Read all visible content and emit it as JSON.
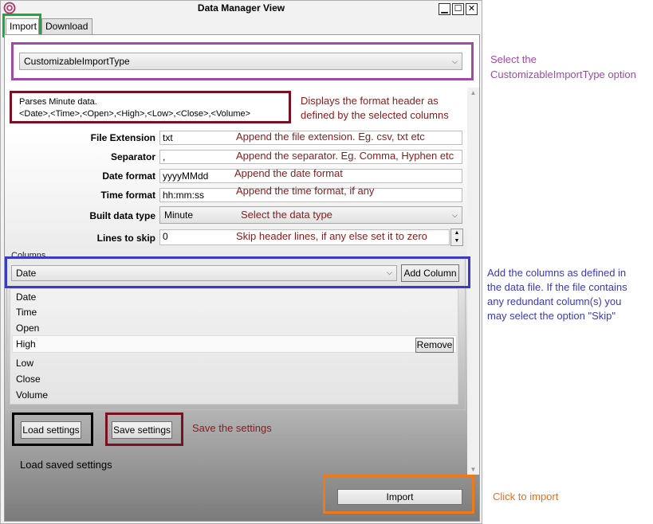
{
  "window": {
    "title": "Data Manager View",
    "minimize_glyph": "▁",
    "maximize_glyph": "☐",
    "close_glyph": "✕"
  },
  "tabs": [
    {
      "label": "Import",
      "active": true
    },
    {
      "label": "Download",
      "active": false
    }
  ],
  "import_type": {
    "selected": "CustomizableImportType"
  },
  "format_header": {
    "line1": "Parses Minute data.",
    "line2": "<Date>,<Time>,<Open>,<High>,<Low>,<Close>,<Volume>"
  },
  "fields": {
    "file_extension": {
      "label": "File Extension",
      "value": "txt"
    },
    "separator": {
      "label": "Separator",
      "value": ","
    },
    "date_format": {
      "label": "Date format",
      "value": "yyyyMMdd"
    },
    "time_format": {
      "label": "Time format",
      "value": "hh:mm:ss"
    },
    "built_data_type": {
      "label": "Built data type",
      "value": "Minute"
    },
    "lines_to_skip": {
      "label": "Lines to skip",
      "value": "0"
    }
  },
  "columns": {
    "group_label": "Columns",
    "selected": "Date",
    "add_label": "Add Column",
    "items": [
      "Date",
      "Time",
      "Open",
      "High",
      "Low",
      "Close",
      "Volume"
    ],
    "remove_label": "Remove"
  },
  "buttons": {
    "load_settings": "Load settings",
    "save_settings": "Save settings",
    "import": "Import"
  },
  "annotations": {
    "header_note": [
      "Displays the format header as",
      "defined by the selected columns"
    ],
    "file_extension_note": "Append the file extension. Eg. csv, txt etc",
    "separator_note": "Append the separator. Eg. Comma, Hyphen etc",
    "date_note": "Append the date format",
    "time_note": "Append the time format, if any",
    "data_type_note": "Select the data type",
    "skip_note": "Skip header lines, if any else set it to zero",
    "save_note": "Save the settings",
    "load_note": "Load saved settings",
    "select_option_note": [
      "Select the",
      "CustomizableImportType option"
    ],
    "columns_note": [
      "Add the columns as defined in",
      "the data file. If the file contains",
      "any redundant column(s) you",
      "may select the option \"Skip\""
    ],
    "import_note": "Click to import"
  },
  "colors": {
    "green_box": "#1fa83a",
    "purple_box": "#a04aa8",
    "maroon_box": "#7a1020",
    "blue_box": "#3a3ac8",
    "black_box": "#000000",
    "orange_box": "#f07a1a",
    "note_red": "#8b1a1a",
    "note_blue": "#3a3ab8",
    "note_orange": "#e8701a"
  }
}
